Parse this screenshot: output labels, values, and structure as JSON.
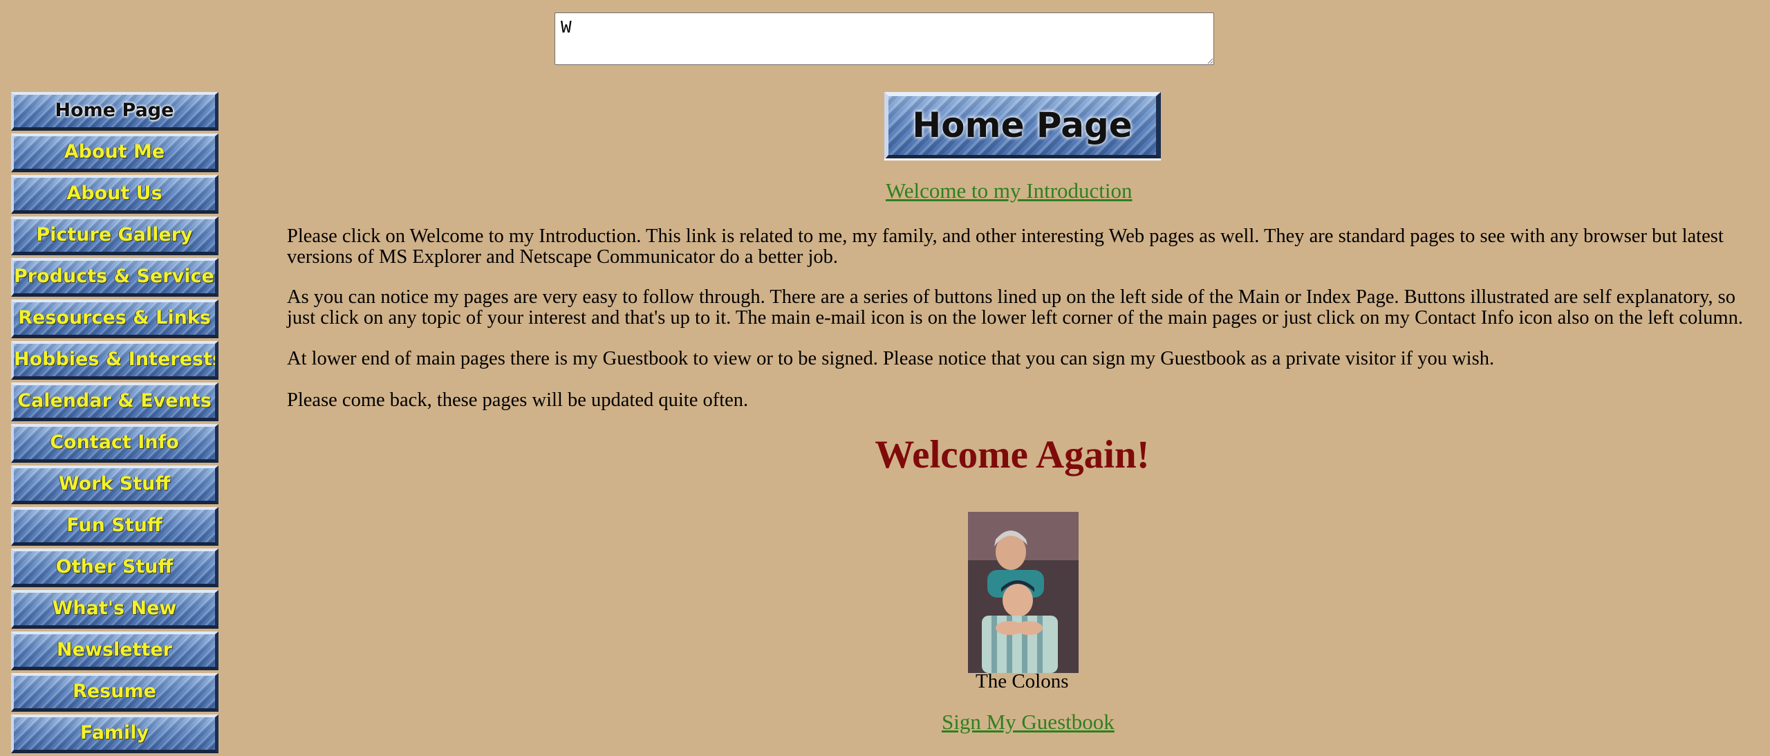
{
  "top_input": {
    "value": "W"
  },
  "sidebar": {
    "items": [
      {
        "label": "Home Page"
      },
      {
        "label": "About Me"
      },
      {
        "label": "About Us"
      },
      {
        "label": "Picture Gallery"
      },
      {
        "label": "Products & Services"
      },
      {
        "label": "Resources & Links"
      },
      {
        "label": "Hobbies & Interests"
      },
      {
        "label": "Calendar & Events"
      },
      {
        "label": "Contact Info"
      },
      {
        "label": "Work Stuff"
      },
      {
        "label": "Fun Stuff"
      },
      {
        "label": "Other Stuff"
      },
      {
        "label": "What's New"
      },
      {
        "label": "Newsletter"
      },
      {
        "label": "Resume"
      },
      {
        "label": "Family"
      }
    ]
  },
  "main": {
    "header_button": "Home Page",
    "intro_link": "Welcome to my Introduction",
    "paragraphs": [
      "Please click on Welcome to my Introduction. This link is related to me, my family, and other interesting Web pages as well. They are standard pages to see with any browser but latest versions of MS Explorer and Netscape Communicator do a better job.",
      "As you can notice my pages are very easy to follow through. There are a series of buttons lined up on the left side of the Main or Index Page. Buttons illustrated are self explanatory, so just click on any topic of your interest and that's up to it. The main e-mail icon is on the lower left corner of the main pages or just click on my Contact Info icon also on the left column.",
      "At lower end of main pages there is my Guestbook to view or to be signed. Please notice that you can sign my Guestbook as a private visitor if you wish.",
      "Please come back, these pages will be updated quite often."
    ],
    "heading": "Welcome Again!",
    "photo_caption": "The Colons",
    "guestbook_link": "Sign My Guestbook"
  },
  "colors": {
    "background": "#d0b28a",
    "link": "#2f7f1f",
    "heading": "#7f0a0a",
    "button_text": "#f2f22a",
    "button_blue": "#5e86c2"
  }
}
